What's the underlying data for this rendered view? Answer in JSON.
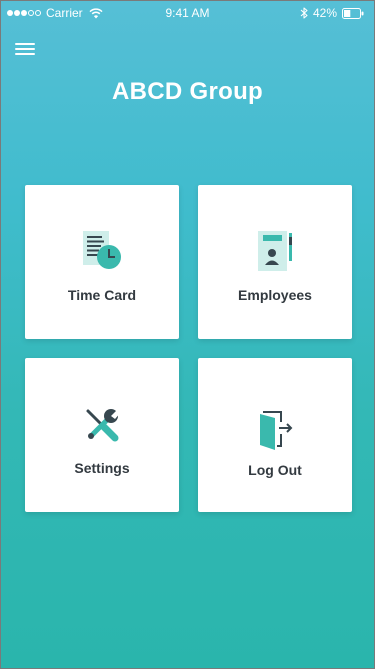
{
  "status_bar": {
    "carrier": "Carrier",
    "time": "9:41 AM",
    "battery": "42%",
    "signal_strength": 3,
    "battery_level": 0.42
  },
  "header": {
    "title": "ABCD Group",
    "menu_icon": "hamburger-menu-icon"
  },
  "tiles": [
    {
      "label": "Time Card",
      "icon": "timecard-icon"
    },
    {
      "label": "Employees",
      "icon": "employee-badge-icon"
    },
    {
      "label": "Settings",
      "icon": "wrench-screwdriver-icon"
    },
    {
      "label": "Log Out",
      "icon": "logout-door-icon"
    }
  ],
  "colors": {
    "gradient_top": "#56bfd6",
    "gradient_bottom": "#2ab5ac",
    "icon_teal": "#3ab9ad",
    "icon_dark": "#37474f",
    "tile_background": "#ffffff"
  }
}
